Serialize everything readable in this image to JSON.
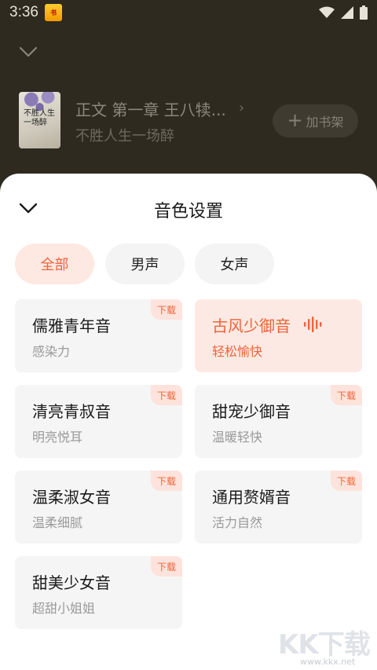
{
  "status_bar": {
    "time": "3:36",
    "app_icon": "novel-app-icon",
    "icons": [
      "wifi-icon",
      "signal-icon",
      "battery-icon"
    ]
  },
  "player": {
    "chapter_title": "正文 第一章 王八犊...",
    "book_title": "不胜人生一场醉",
    "cover_text": "不胜人生一场醉",
    "shelf_plus": "+",
    "shelf_label": "加书架"
  },
  "sheet": {
    "title": "音色设置",
    "filters": [
      {
        "label": "全部",
        "active": true
      },
      {
        "label": "男声",
        "active": false
      },
      {
        "label": "女声",
        "active": false
      }
    ],
    "voices": [
      {
        "name": "儒雅青年音",
        "desc": "感染力",
        "badge": "下载",
        "selected": false
      },
      {
        "name": "古风少御音",
        "desc": "轻松愉快",
        "badge": "",
        "selected": true
      },
      {
        "name": "清亮青叔音",
        "desc": "明亮悦耳",
        "badge": "下载",
        "selected": false
      },
      {
        "name": "甜宠少御音",
        "desc": "温暖轻快",
        "badge": "下载",
        "selected": false
      },
      {
        "name": "温柔淑女音",
        "desc": "温柔细腻",
        "badge": "下载",
        "selected": false
      },
      {
        "name": "通用赘婿音",
        "desc": "活力自然",
        "badge": "下载",
        "selected": false
      },
      {
        "name": "甜美少女音",
        "desc": "超甜小姐姐",
        "badge": "下载",
        "selected": false
      }
    ]
  },
  "watermark": {
    "text": "KK下载",
    "url": "www.kkx.net"
  },
  "colors": {
    "accent": "#f0643a",
    "accent_bg": "#fde9e3",
    "card_bg": "#f5f5f5",
    "overlay_bg": "#2e2a20"
  }
}
